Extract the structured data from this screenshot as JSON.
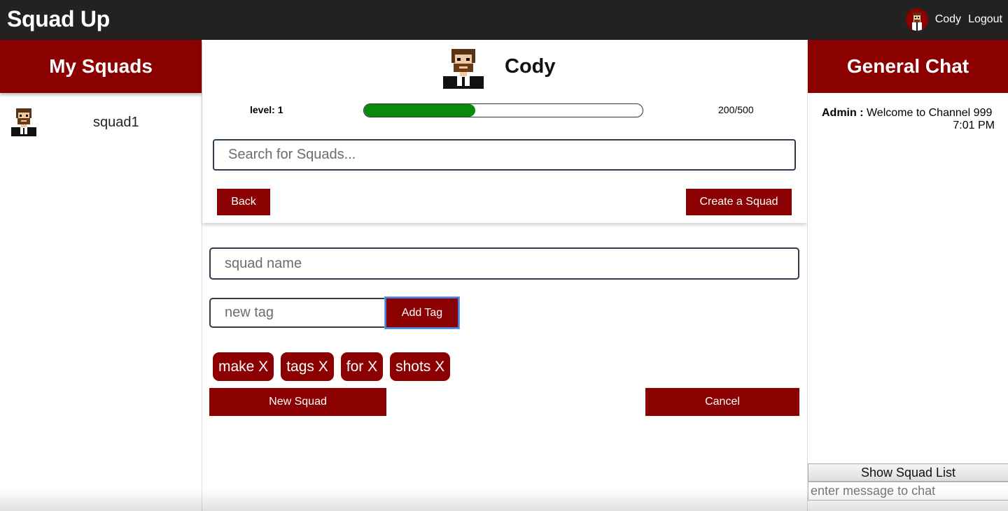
{
  "app": {
    "title": "Squad Up"
  },
  "user": {
    "name": "Cody",
    "logout_label": "Logout",
    "avatar_icon": "pixel-avatar-icon"
  },
  "left": {
    "header": "My Squads",
    "squads": [
      {
        "name": "squad1"
      }
    ]
  },
  "profile": {
    "name": "Cody",
    "level_label": "level: 1",
    "xp_text": "200/500",
    "xp_fraction": 0.4,
    "search_placeholder": "Search for Squads...",
    "back_label": "Back",
    "create_label": "Create a Squad"
  },
  "form": {
    "squad_name_placeholder": "squad name",
    "tag_placeholder": "new tag",
    "add_tag_label": "Add Tag",
    "tags": [
      "make X",
      "tags X",
      "for X",
      "shots X"
    ],
    "new_squad_label": "New Squad",
    "cancel_label": "Cancel"
  },
  "chat": {
    "header": "General Chat",
    "messages": [
      {
        "author": "Admin :",
        "text": " Welcome to Channel 999",
        "time": "7:01 PM"
      }
    ],
    "show_squad_list_label": "Show Squad List",
    "input_placeholder": "enter message to chat"
  },
  "colors": {
    "brand_red": "#8b0000",
    "topbar": "#222222",
    "xp_green": "#0a8a0a"
  }
}
